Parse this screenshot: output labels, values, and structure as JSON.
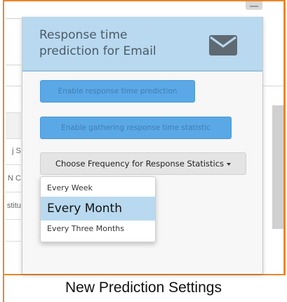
{
  "popup": {
    "title": "Response time prediction for Email",
    "icon": "envelope-icon",
    "enable_prediction_label": "Enable response time prediction",
    "enable_gathering_label": "Enable gathering response time statistic",
    "frequency_dropdown_label": "Choose Frequency for Response Statistics",
    "frequency_options": [
      "Every Week",
      "Every Month",
      "Every Three Months"
    ],
    "highlighted_option": "Every Month"
  },
  "background_page": {
    "row_fragments": [
      "j S",
      "N C",
      "stitu"
    ]
  },
  "caption": "New Prediction Settings",
  "colors": {
    "frame_accent": "#e8872a",
    "header_bg": "#b8d9ef",
    "button_blue": "#5aa8e6",
    "highlight_bg": "#b8d9ef"
  }
}
